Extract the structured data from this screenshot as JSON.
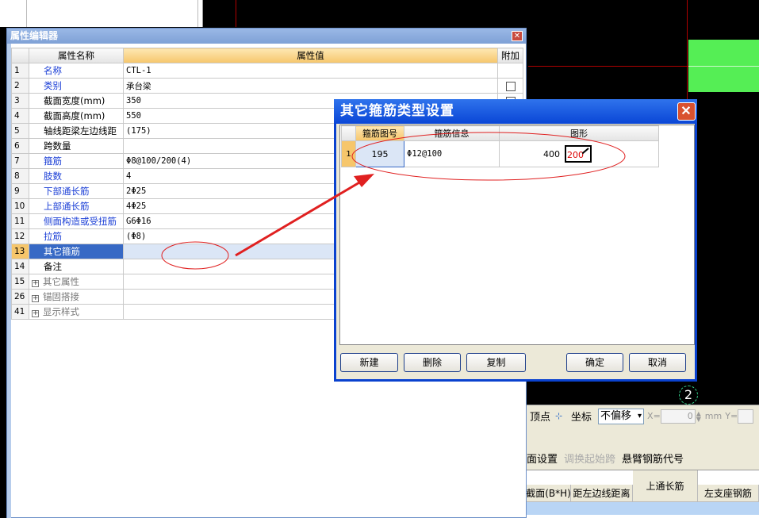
{
  "property_editor": {
    "title": "属性编辑器",
    "close_glyph": "✕",
    "headers": {
      "name": "属性名称",
      "value": "属性值",
      "add": "附加"
    },
    "rows": [
      {
        "idx": "1",
        "name": "名称",
        "value": "CTL-1",
        "blue": true,
        "checkbox": false
      },
      {
        "idx": "2",
        "name": "类别",
        "value": "承台梁",
        "blue": true,
        "checkbox": true
      },
      {
        "idx": "3",
        "name": "截面宽度(mm)",
        "value": "350",
        "blue": false,
        "checkbox": true
      },
      {
        "idx": "4",
        "name": "截面高度(mm)",
        "value": "550",
        "blue": false,
        "checkbox": false
      },
      {
        "idx": "5",
        "name": "轴线距梁左边线距",
        "value": "(175)",
        "blue": false,
        "checkbox": false
      },
      {
        "idx": "6",
        "name": "跨数量",
        "value": "",
        "blue": false,
        "checkbox": false
      },
      {
        "idx": "7",
        "name": "箍筋",
        "value": "Φ8@100/200(4)",
        "blue": true,
        "checkbox": false
      },
      {
        "idx": "8",
        "name": "肢数",
        "value": "4",
        "blue": true,
        "checkbox": false
      },
      {
        "idx": "9",
        "name": "下部通长筋",
        "value": "2Φ25",
        "blue": true,
        "checkbox": false
      },
      {
        "idx": "10",
        "name": "上部通长筋",
        "value": "4Φ25",
        "blue": true,
        "checkbox": false
      },
      {
        "idx": "11",
        "name": "侧面构造或受扭筋",
        "value": "G6Φ16",
        "blue": true,
        "checkbox": false
      },
      {
        "idx": "12",
        "name": "拉筋",
        "value": "(Φ8)",
        "blue": true,
        "checkbox": false
      },
      {
        "idx": "13",
        "name": "其它箍筋",
        "value": "",
        "blue": false,
        "checkbox": false,
        "selected": true
      },
      {
        "idx": "14",
        "name": "备注",
        "value": "",
        "blue": false,
        "checkbox": false
      },
      {
        "idx": "15",
        "name": "其它属性",
        "value": "",
        "expand": true
      },
      {
        "idx": "26",
        "name": "锚固搭接",
        "value": "",
        "expand": true
      },
      {
        "idx": "41",
        "name": "显示样式",
        "value": "",
        "expand": true
      }
    ]
  },
  "dialog": {
    "title": "其它箍筋类型设置",
    "close_glyph": "✕",
    "headers": {
      "code": "箍筋图号",
      "info": "箍筋信息",
      "shape": "图形"
    },
    "rows": [
      {
        "idx": "1",
        "code": "195",
        "info": "Φ12@100",
        "shape_left": "400",
        "shape_inner": "200"
      }
    ],
    "buttons": {
      "new": "新建",
      "delete": "删除",
      "copy": "复制",
      "ok": "确定",
      "cancel": "取消"
    }
  },
  "toolbar": {
    "vertex": "顶点",
    "coord": "坐标",
    "offset": "不偏移",
    "x_label": "X=",
    "x_value": "0",
    "unit": "mm",
    "y_label": "Y="
  },
  "lower_panel": {
    "menu": [
      "面设置",
      "调换起始跨",
      "悬臂钢筋代号"
    ],
    "columns": [
      "截面(B*H)",
      "距左边线距离",
      "上通长筋",
      "左支座钢筋"
    ]
  },
  "cad": {
    "axis_label": "2"
  },
  "colors": {
    "title_blue": "#0a46d6",
    "selected_blue": "#3769c5",
    "header_orange": "#f6c66b",
    "annotation_red": "#e02020"
  }
}
